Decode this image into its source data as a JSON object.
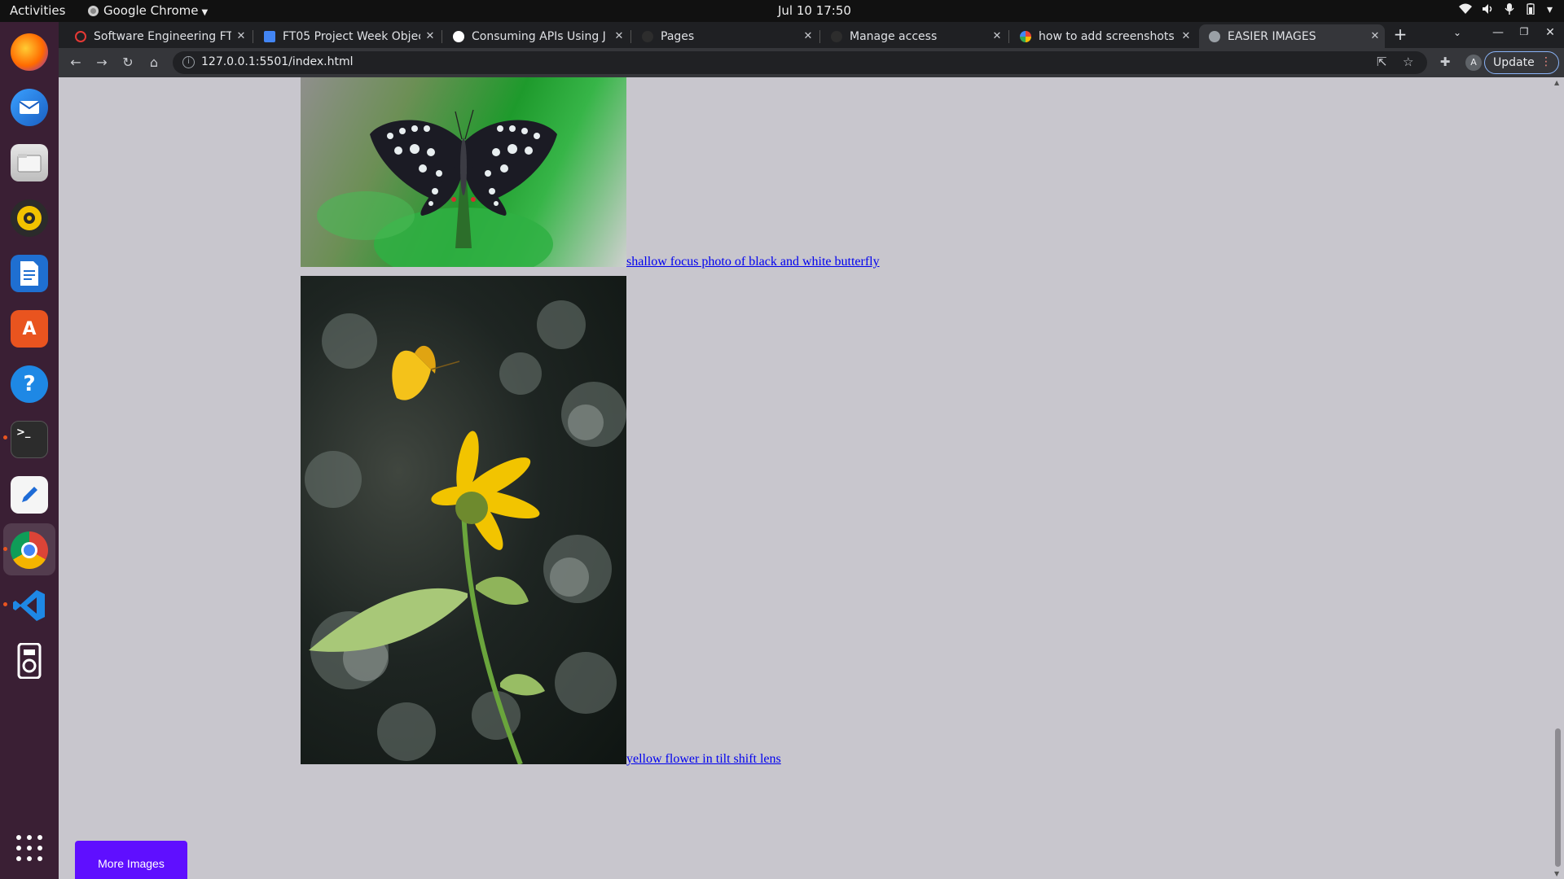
{
  "system": {
    "activities": "Activities",
    "app_name": "Google Chrome",
    "clock": "Jul 10  17:50"
  },
  "tabs": [
    {
      "title": "Software Engineering FT",
      "favicon_color": "#e53935",
      "active": false
    },
    {
      "title": "FT05 Project Week Objec",
      "favicon_color": "#4285f4",
      "active": false
    },
    {
      "title": "Consuming APIs Using J",
      "favicon_color": "#ffffff",
      "active": false
    },
    {
      "title": "Pages",
      "favicon_color": "#2d2d2d",
      "active": false
    },
    {
      "title": "Manage access",
      "favicon_color": "#2d2d2d",
      "active": false
    },
    {
      "title": "how to add screenshots",
      "favicon_color": "#4285f4",
      "active": false
    },
    {
      "title": "EASIER IMAGES",
      "favicon_color": "#9aa0a6",
      "active": true
    }
  ],
  "toolbar": {
    "url": "127.0.0.1:5501/index.html",
    "update_label": "Update",
    "avatar_letter": "A"
  },
  "page": {
    "images": [
      {
        "caption": "shallow focus photo of black and white butterfly"
      },
      {
        "caption": "yellow flower in tilt shift lens"
      }
    ],
    "more_button": "More Images"
  },
  "colors": {
    "page_background": "#c8c6cd",
    "accent_button": "#5f0fff",
    "link": "#0000ee"
  }
}
